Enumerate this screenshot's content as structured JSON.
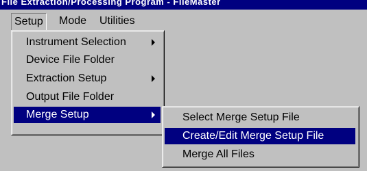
{
  "title_bar": {
    "text": "File Extraction/Processing Program - FileMaster"
  },
  "menubar": {
    "items": [
      {
        "label": "Setup",
        "underline": "S"
      },
      {
        "label": "Mode",
        "underline": "M"
      },
      {
        "label": "Utilities",
        "underline": "U"
      }
    ]
  },
  "setup_menu": {
    "items": [
      {
        "label": "Instrument Selection",
        "has_submenu": true
      },
      {
        "label": "Device File Folder",
        "has_submenu": false
      },
      {
        "label": "Extraction Setup",
        "has_submenu": true
      },
      {
        "label": "Output File Folder",
        "has_submenu": false
      },
      {
        "label": "Merge Setup",
        "has_submenu": true,
        "highlighted": true
      }
    ]
  },
  "merge_submenu": {
    "items": [
      {
        "label": "Select Merge Setup File",
        "highlighted": false
      },
      {
        "label": "Create/Edit Merge Setup File",
        "highlighted": true
      },
      {
        "label": "Merge All Files",
        "highlighted": false
      }
    ]
  },
  "colors": {
    "face": "#c0c0c0",
    "highlight": "#000080",
    "title_bar": "#000080"
  }
}
